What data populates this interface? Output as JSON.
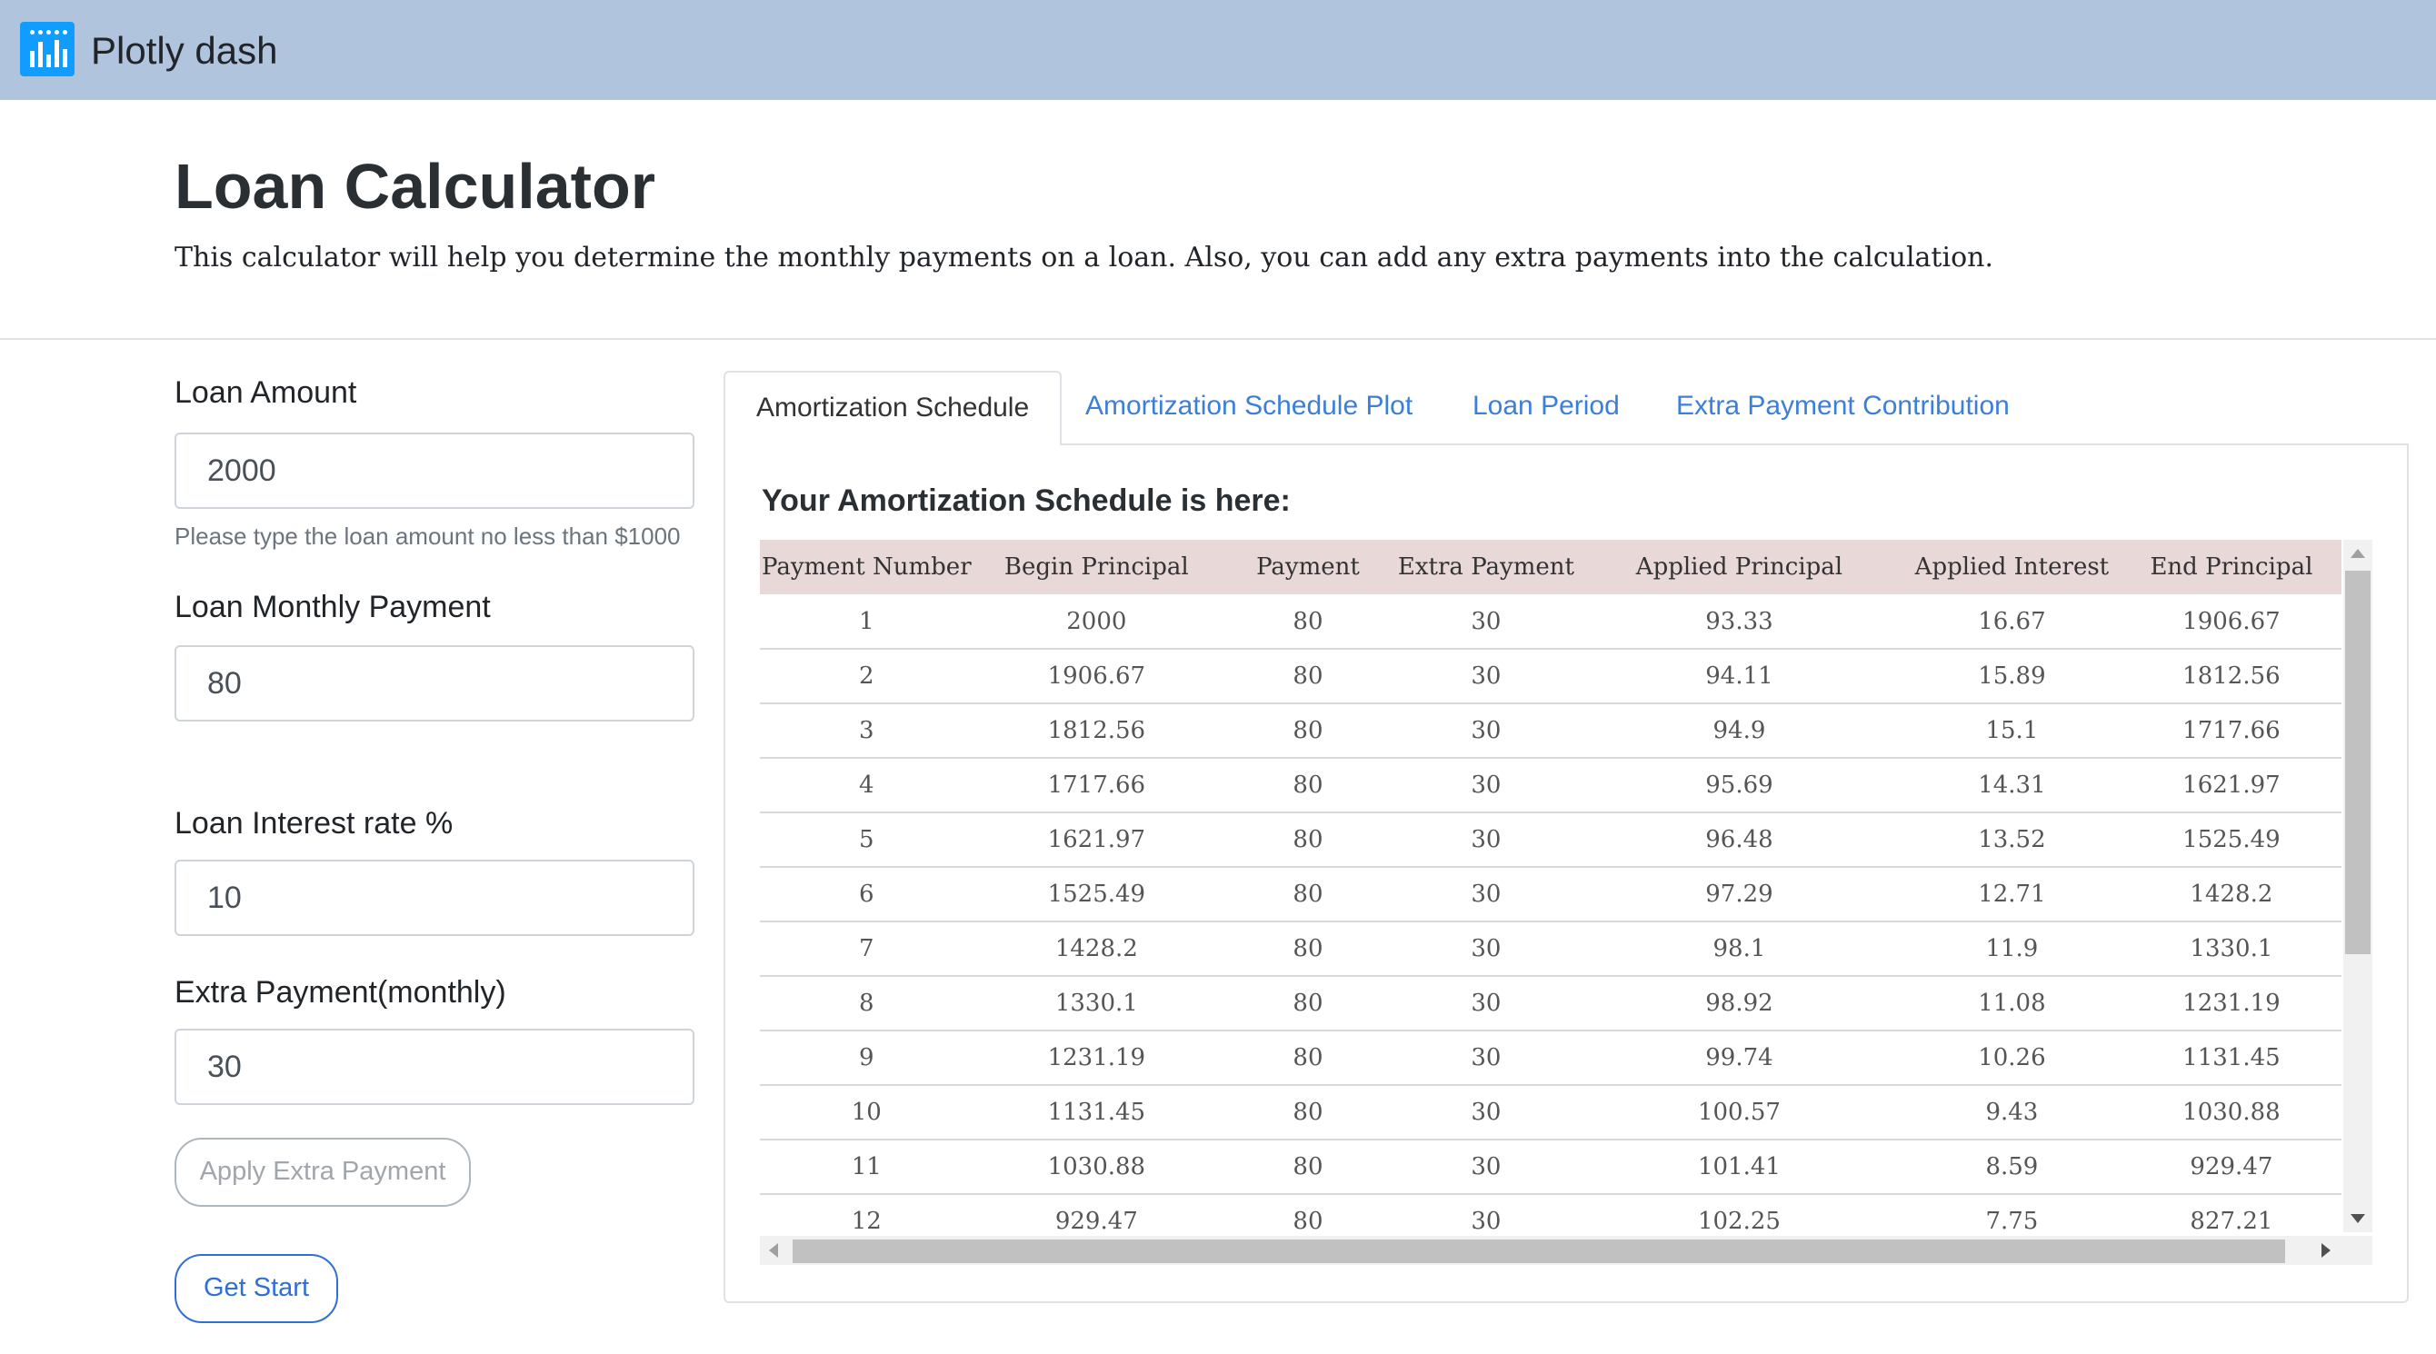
{
  "navbar": {
    "brand": "Plotly dash",
    "logo_icon": "plotly-logo-icon",
    "background": "#b0c4de"
  },
  "header": {
    "title": "Loan Calculator",
    "subtitle": "This calculator will help you determine the monthly payments on a loan. Also, you can add any extra payments into the calculation."
  },
  "form": {
    "loan_amount_label": "Loan Amount",
    "loan_amount_value": "2000",
    "loan_amount_help": "Please type the loan amount no less than $1000",
    "monthly_payment_label": "Loan Monthly Payment",
    "monthly_payment_value": "80",
    "interest_rate_label": "Loan Interest rate %",
    "interest_rate_value": "10",
    "extra_payment_label": "Extra Payment(monthly)",
    "extra_payment_value": "30",
    "apply_button": "Apply Extra Payment",
    "start_button": "Get Start"
  },
  "tabs": [
    {
      "label": "Amortization Schedule",
      "active": true
    },
    {
      "label": "Amortization Schedule Plot",
      "active": false
    },
    {
      "label": "Loan Period",
      "active": false
    },
    {
      "label": "Extra Payment Contribution",
      "active": false
    }
  ],
  "schedule": {
    "title": "Your Amortization Schedule is here:",
    "columns": [
      "Payment Number",
      "Begin Principal",
      "Payment",
      "Extra Payment",
      "Applied Principal",
      "Applied Interest",
      "End Principal"
    ],
    "rows": [
      [
        "1",
        "2000",
        "80",
        "30",
        "93.33",
        "16.67",
        "1906.67"
      ],
      [
        "2",
        "1906.67",
        "80",
        "30",
        "94.11",
        "15.89",
        "1812.56"
      ],
      [
        "3",
        "1812.56",
        "80",
        "30",
        "94.9",
        "15.1",
        "1717.66"
      ],
      [
        "4",
        "1717.66",
        "80",
        "30",
        "95.69",
        "14.31",
        "1621.97"
      ],
      [
        "5",
        "1621.97",
        "80",
        "30",
        "96.48",
        "13.52",
        "1525.49"
      ],
      [
        "6",
        "1525.49",
        "80",
        "30",
        "97.29",
        "12.71",
        "1428.2"
      ],
      [
        "7",
        "1428.2",
        "80",
        "30",
        "98.1",
        "11.9",
        "1330.1"
      ],
      [
        "8",
        "1330.1",
        "80",
        "30",
        "98.92",
        "11.08",
        "1231.19"
      ],
      [
        "9",
        "1231.19",
        "80",
        "30",
        "99.74",
        "10.26",
        "1131.45"
      ],
      [
        "10",
        "1131.45",
        "80",
        "30",
        "100.57",
        "9.43",
        "1030.88"
      ],
      [
        "11",
        "1030.88",
        "80",
        "30",
        "101.41",
        "8.59",
        "929.47"
      ],
      [
        "12",
        "929.47",
        "80",
        "30",
        "102.25",
        "7.75",
        "827.21"
      ]
    ]
  }
}
